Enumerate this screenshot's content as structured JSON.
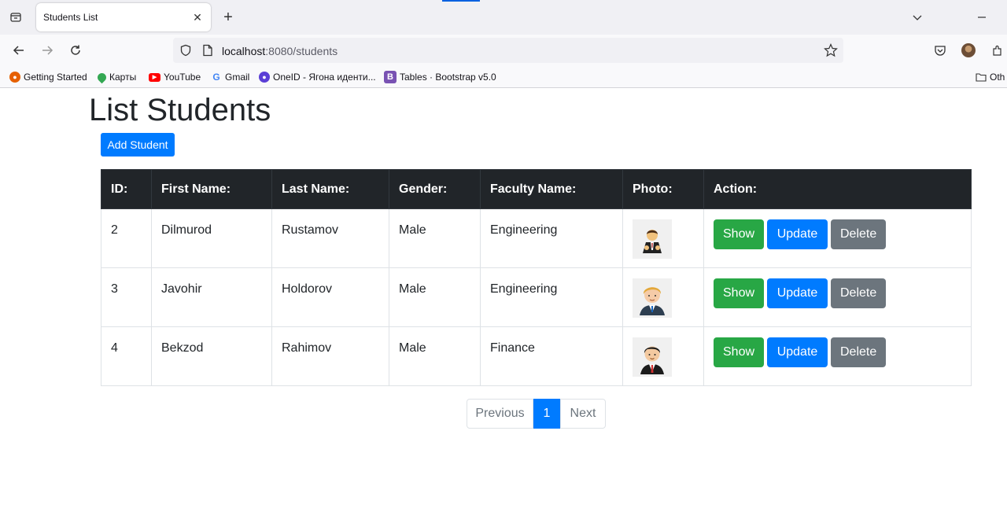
{
  "browser": {
    "tab_title": "Students List",
    "url_host": "localhost",
    "url_rest": ":8080/students",
    "bookmarks": [
      {
        "label": "Getting Started",
        "icon": "firefox-icon",
        "color": "#e66000"
      },
      {
        "label": "Карты",
        "icon": "maps-pin-icon",
        "color": "#34a853"
      },
      {
        "label": "YouTube",
        "icon": "youtube-icon",
        "color": "#ff0000"
      },
      {
        "label": "Gmail",
        "icon": "google-icon",
        "color": "#4285f4"
      },
      {
        "label": "OneID - Ягона иденти...",
        "icon": "oneid-icon",
        "color": "#5b3fd6"
      },
      {
        "label": "Tables · Bootstrap v5.0",
        "icon": "bootstrap-icon",
        "color": "#7952b3"
      },
      {
        "label": "Oth",
        "icon": "folder-icon",
        "color": "#333333"
      }
    ]
  },
  "page": {
    "title": "List Students",
    "add_button": "Add Student",
    "columns": [
      "ID:",
      "First Name:",
      "Last Name:",
      "Gender:",
      "Faculty Name:",
      "Photo:",
      "Action:"
    ],
    "rows": [
      {
        "id": "2",
        "first": "Dilmurod",
        "last": "Rustamov",
        "gender": "Male",
        "faculty": "Engineering",
        "photo": "businessman-avatar"
      },
      {
        "id": "3",
        "first": "Javohir",
        "last": "Holdorov",
        "gender": "Male",
        "faculty": "Engineering",
        "photo": "blond-man-avatar"
      },
      {
        "id": "4",
        "first": "Bekzod",
        "last": "Rahimov",
        "gender": "Male",
        "faculty": "Finance",
        "photo": "man-red-tie-avatar"
      }
    ],
    "actions": {
      "show": "Show",
      "update": "Update",
      "delete": "Delete"
    },
    "pagination": {
      "previous": "Previous",
      "current": "1",
      "next": "Next"
    }
  },
  "colors": {
    "primary": "#007bff",
    "success": "#28a745",
    "secondary": "#6c757d",
    "table_header": "#212529"
  }
}
